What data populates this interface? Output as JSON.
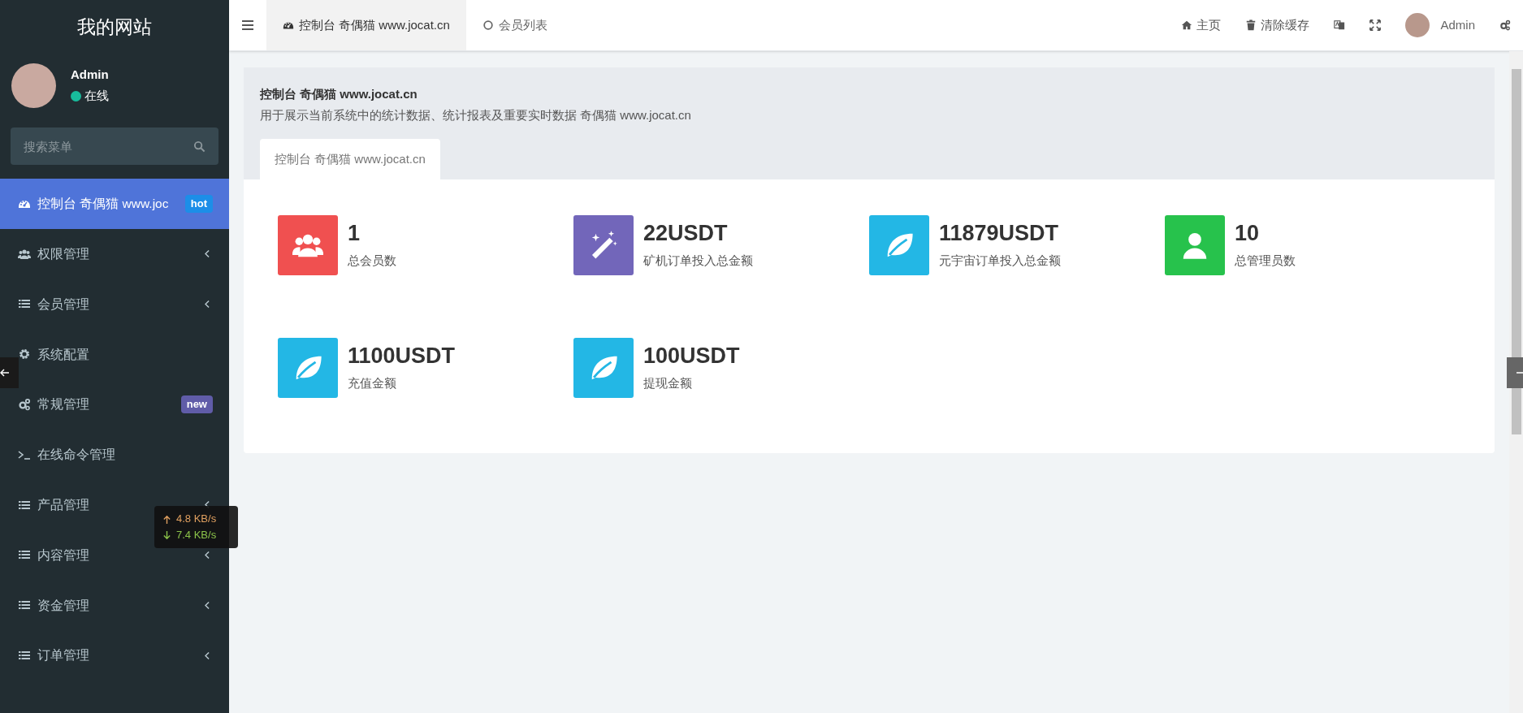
{
  "sidebar": {
    "title": "我的网站",
    "user": {
      "name": "Admin",
      "status": "在线",
      "online": true
    },
    "search": {
      "placeholder": "搜索菜单"
    },
    "items": [
      {
        "label": "控制台 奇偶猫 www.joc",
        "kind": "dashboard",
        "selected": true,
        "submenu": false,
        "badge": {
          "text": "hot",
          "color": "#1c8ee8"
        }
      },
      {
        "label": "权限管理",
        "kind": "users",
        "selected": false,
        "submenu": true
      },
      {
        "label": "会员管理",
        "kind": "list",
        "selected": false,
        "submenu": true
      },
      {
        "label": "系统配置",
        "kind": "gear",
        "selected": false,
        "submenu": false
      },
      {
        "label": "常规管理",
        "kind": "gears",
        "selected": false,
        "submenu": false,
        "badge": {
          "text": "new",
          "color": "#605ca8"
        }
      },
      {
        "label": "在线命令管理",
        "kind": "terminal",
        "selected": false,
        "submenu": false
      },
      {
        "label": "产品管理",
        "kind": "list",
        "selected": false,
        "submenu": true
      },
      {
        "label": "内容管理",
        "kind": "list",
        "selected": false,
        "submenu": true
      },
      {
        "label": "资金管理",
        "kind": "list",
        "selected": false,
        "submenu": true
      },
      {
        "label": "订单管理",
        "kind": "list",
        "selected": false,
        "submenu": true
      }
    ]
  },
  "topbar": {
    "tabs": [
      {
        "label": "控制台 奇偶猫 www.jocat.cn",
        "kind": "dashboard",
        "selected": true
      },
      {
        "label": "会员列表",
        "kind": "circle",
        "selected": false
      }
    ],
    "actions": [
      {
        "kind": "home",
        "label": "主页"
      },
      {
        "kind": "trash",
        "label": "清除缓存"
      },
      {
        "kind": "translate"
      },
      {
        "kind": "fullscreen"
      },
      {
        "kind": "user",
        "label": "Admin"
      },
      {
        "kind": "gears"
      }
    ]
  },
  "page": {
    "title": "控制台 奇偶猫 www.jocat.cn",
    "description": "用于展示当前系统中的统计数据、统计报表及重要实时数据 奇偶猫 www.jocat.cn",
    "tabs": [
      {
        "label": "控制台 奇偶猫 www.jocat.cn",
        "selected": true
      }
    ],
    "stats": [
      {
        "value": "1",
        "label": "总会员数",
        "kind": "users",
        "color": "#f05050"
      },
      {
        "value": "22USDT",
        "label": "矿机订单投入总金额",
        "kind": "wand",
        "color": "#7266ba"
      },
      {
        "value": "11879USDT",
        "label": "元宇宙订单投入总金额",
        "kind": "leaf",
        "color": "#23b7e5"
      },
      {
        "value": "10",
        "label": "总管理员数",
        "kind": "user",
        "color": "#27c24c"
      },
      {
        "value": "1100USDT",
        "label": "充值金额",
        "kind": "leaf",
        "color": "#23b7e5"
      },
      {
        "value": "100USDT",
        "label": "提现金额",
        "kind": "leaf",
        "color": "#23b7e5"
      }
    ]
  },
  "network_speed": {
    "upload": "4.8 KB/s",
    "download": "7.4 KB/s"
  }
}
